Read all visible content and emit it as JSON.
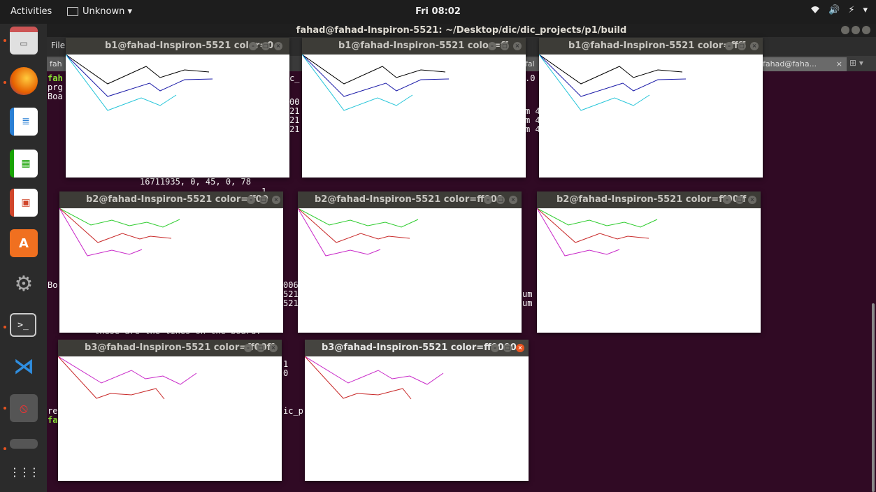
{
  "topbar": {
    "activities": "Activities",
    "app_name": "Unknown ▾",
    "clock": "Fri 08:02",
    "tray": [
      "▾",
      "🔊",
      "⚡",
      "▾"
    ]
  },
  "dock": {
    "items": [
      "files-icon",
      "firefox-icon",
      "writer-icon",
      "calc-icon",
      "impress-icon",
      "software-icon",
      "settings-icon",
      "terminal-icon",
      "vscode-icon",
      "app-icon",
      "app-icon-2"
    ],
    "show_apps": "⋮⋮⋮"
  },
  "terminal": {
    "title": "fahad@fahad-Inspiron-5521: ~/Desktop/dic/dic_projects/p1/build",
    "menu_file": "File",
    "tabs": [
      "fah",
      "fal",
      "fahad@faha..."
    ],
    "tab_close": "×",
    "lines": {
      "l1": "fah",
      "l2": "prg",
      "l3": "Boa",
      "l4": "16711935, 0, 45, 0, 78",
      "l5": "Bo",
      "l6": "these are the lines on the board:",
      "l7": "re",
      "l8": "fa",
      "r1": "00",
      "r2": "21",
      "r3": "21",
      "r4": "21",
      "r5": "006",
      "r6": "521",
      "r7": "521",
      "r8": "1",
      "r9": "0",
      "r10": "ic_p",
      "m1": "m 4",
      "m2": "m 4",
      "m3": "m 4",
      "m4": "um",
      "m5": "um",
      "c1": "c_",
      "c2": ".0"
    }
  },
  "windows": [
    {
      "title": "b1@fahad-Inspiron-5521 color=0",
      "series": [
        {
          "color": "#000000",
          "x": [
            0,
            60,
            115,
            135,
            170,
            205
          ],
          "y": [
            0,
            42,
            17,
            33,
            22,
            25
          ]
        },
        {
          "color": "#1a1aa8",
          "x": [
            0,
            60,
            120,
            135,
            170,
            210
          ],
          "y": [
            0,
            60,
            41,
            52,
            36,
            35
          ]
        },
        {
          "color": "#22c4d8",
          "x": [
            0,
            60,
            108,
            135,
            158
          ],
          "y": [
            0,
            80,
            62,
            73,
            58
          ]
        }
      ]
    },
    {
      "title": "b1@fahad-Inspiron-5521 color=ff",
      "series": [
        {
          "color": "#000000",
          "x": [
            0,
            60,
            115,
            135,
            170,
            205
          ],
          "y": [
            0,
            42,
            17,
            33,
            22,
            25
          ]
        },
        {
          "color": "#1a1aa8",
          "x": [
            0,
            60,
            120,
            135,
            170,
            210
          ],
          "y": [
            0,
            60,
            41,
            52,
            36,
            35
          ]
        },
        {
          "color": "#22c4d8",
          "x": [
            0,
            60,
            108,
            135,
            158
          ],
          "y": [
            0,
            80,
            62,
            73,
            58
          ]
        }
      ]
    },
    {
      "title": "b1@fahad-Inspiron-5521 color=ffff",
      "series": [
        {
          "color": "#000000",
          "x": [
            0,
            60,
            115,
            135,
            170,
            205
          ],
          "y": [
            0,
            42,
            17,
            33,
            22,
            25
          ]
        },
        {
          "color": "#1a1aa8",
          "x": [
            0,
            60,
            120,
            135,
            170,
            210
          ],
          "y": [
            0,
            60,
            41,
            52,
            36,
            35
          ]
        },
        {
          "color": "#22c4d8",
          "x": [
            0,
            60,
            108,
            135,
            158
          ],
          "y": [
            0,
            80,
            62,
            73,
            58
          ]
        }
      ]
    },
    {
      "title": "b2@fahad-Inspiron-5521 color=ff00",
      "series": [
        {
          "color": "#2ecc2e",
          "x": [
            0,
            45,
            75,
            100,
            125,
            148,
            172
          ],
          "y": [
            0,
            24,
            17,
            25,
            20,
            27,
            16
          ]
        },
        {
          "color": "#c82828",
          "x": [
            0,
            55,
            90,
            115,
            130,
            160
          ],
          "y": [
            0,
            49,
            36,
            44,
            40,
            43
          ]
        },
        {
          "color": "#c828c8",
          "x": [
            0,
            40,
            75,
            100,
            118
          ],
          "y": [
            0,
            68,
            60,
            66,
            59
          ]
        }
      ]
    },
    {
      "title": "b2@fahad-Inspiron-5521 color=ff000",
      "series": [
        {
          "color": "#2ecc2e",
          "x": [
            0,
            45,
            75,
            100,
            125,
            148,
            172
          ],
          "y": [
            0,
            24,
            17,
            25,
            20,
            27,
            16
          ]
        },
        {
          "color": "#c82828",
          "x": [
            0,
            55,
            90,
            115,
            130,
            160
          ],
          "y": [
            0,
            49,
            36,
            44,
            40,
            43
          ]
        },
        {
          "color": "#c828c8",
          "x": [
            0,
            40,
            75,
            100,
            118
          ],
          "y": [
            0,
            68,
            60,
            66,
            59
          ]
        }
      ]
    },
    {
      "title": "b2@fahad-Inspiron-5521 color=ff00ff",
      "series": [
        {
          "color": "#2ecc2e",
          "x": [
            0,
            45,
            75,
            100,
            125,
            148,
            172
          ],
          "y": [
            0,
            24,
            17,
            25,
            20,
            27,
            16
          ]
        },
        {
          "color": "#c82828",
          "x": [
            0,
            55,
            90,
            115,
            130,
            160
          ],
          "y": [
            0,
            49,
            36,
            44,
            40,
            43
          ]
        },
        {
          "color": "#c828c8",
          "x": [
            0,
            40,
            75,
            100,
            118
          ],
          "y": [
            0,
            68,
            60,
            66,
            59
          ]
        }
      ]
    },
    {
      "title": "b3@fahad-Inspiron-5521 color=ff00ff",
      "series": [
        {
          "color": "#c828c8",
          "x": [
            0,
            62,
            105,
            125,
            150,
            175,
            198
          ],
          "y": [
            0,
            38,
            20,
            32,
            28,
            40,
            24
          ]
        },
        {
          "color": "#c82828",
          "x": [
            0,
            55,
            75,
            105,
            140,
            152
          ],
          "y": [
            0,
            60,
            53,
            55,
            46,
            61
          ]
        }
      ]
    },
    {
      "title": "b3@fahad-Inspiron-5521 color=ff0000",
      "series": [
        {
          "color": "#c828c8",
          "x": [
            0,
            62,
            105,
            125,
            150,
            175,
            198
          ],
          "y": [
            0,
            38,
            20,
            32,
            28,
            40,
            24
          ]
        },
        {
          "color": "#c82828",
          "x": [
            0,
            55,
            75,
            105,
            140,
            152
          ],
          "y": [
            0,
            60,
            53,
            55,
            46,
            61
          ]
        }
      ]
    }
  ],
  "window_controls": [
    "–",
    "▢",
    "×"
  ]
}
